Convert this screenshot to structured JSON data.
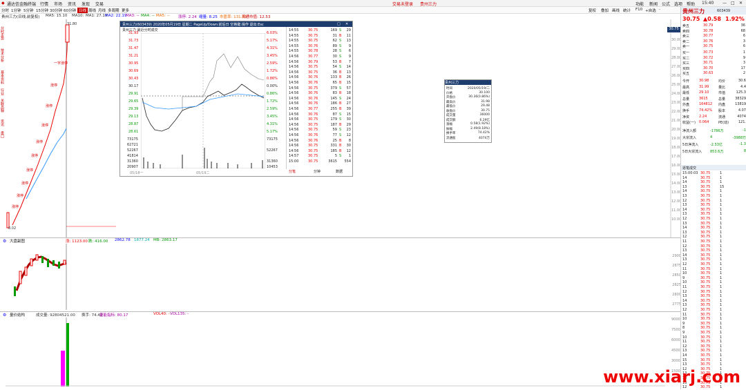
{
  "titlebar": {
    "app": "通达信金融终端",
    "menus": [
      "行情",
      "市场",
      "资讯",
      "发现",
      "交易"
    ],
    "center_items": [
      "交易未登录",
      "贵州三力"
    ],
    "right_items": [
      "功能",
      "新闻",
      "公式",
      "选项",
      "帮助"
    ],
    "time": "15:40"
  },
  "toolbar": {
    "items": [
      "分时",
      "1分钟",
      "5分钟",
      "15分钟",
      "30分钟",
      "60分钟",
      "日线",
      "周线",
      "月线",
      "多周期",
      "更多"
    ],
    "right_items": [
      "复权",
      "叠加",
      "画线",
      "统计",
      "F10",
      "+自选",
      "-"
    ]
  },
  "ma_line": {
    "label": "贵州三力(日线,前复权)",
    "items": [
      {
        "text": "MA5: 15.10",
        "color": "#333"
      },
      {
        "text": "MA10:",
        "color": "#333"
      },
      {
        "text": "MA1: 27.19",
        "color": "#333"
      },
      {
        "text": "MA2: 22.19",
        "color": "#00f"
      },
      {
        "text": "MA3: --",
        "color": "#a0a"
      },
      {
        "text": "MA4: --",
        "color": "#090"
      },
      {
        "text": "MA5: --",
        "color": "#e60"
      }
    ],
    "extra": [
      "涨停: 2.24",
      "缩量: 8.25",
      "市盈率: 131.63",
      "流通市值: 12.53"
    ]
  },
  "left_tabs": [
    "分时走势",
    "技术分析",
    "基本资料",
    "行业",
    "关联品种",
    "资讯",
    "盘口"
  ],
  "main_chart": {
    "high_label": "31.80",
    "low_label": "8.02",
    "annotations": [
      "一字涨停",
      "涨停",
      "涨停",
      "涨停",
      "涨停",
      "涨停",
      "涨停",
      "涨停",
      "涨停",
      "涨停",
      "涨停",
      "涨停"
    ],
    "axis": [
      "30.75",
      "30.00",
      "29.00",
      "28.00",
      "27.00",
      "26.00",
      "25.00",
      "24.00",
      "23.00",
      "22.00",
      "21.00",
      "20.00",
      "19.00",
      "18.00",
      "17.00",
      "16.00",
      "15.00",
      "14.00",
      "13.00",
      "12.00",
      "11.00",
      "10.00"
    ]
  },
  "popup": {
    "title": "贵州三力(603439) 2020年05月19日 星期二 PageUp/Down:前后日 空格键:操作 退出:Esc",
    "subtitle": "贵州三力  最近分时成交",
    "price_left": [
      "31.93",
      "31.73",
      "31.47",
      "31.21",
      "30.95",
      "30.69",
      "30.43",
      "30.17",
      "29.91",
      "29.65",
      "29.39",
      "29.13",
      "28.87",
      "28.61"
    ],
    "pct_right": [
      "6.03%",
      "5.17%",
      "4.31%",
      "3.45%",
      "2.59%",
      "1.72%",
      "0.86%",
      "0.00%",
      "0.86%",
      "1.72%",
      "2.59%",
      "3.45%",
      "4.31%",
      "5.17%"
    ],
    "vol_left": [
      "73175",
      "62721",
      "52267",
      "41814",
      "31360",
      "20907",
      "10453"
    ],
    "date_labels": [
      "05/18一",
      "05/19二"
    ],
    "ticks": [
      {
        "t": "14:55",
        "p": "30.75",
        "v": "169",
        "bs": "S",
        "n": "29"
      },
      {
        "t": "14:55",
        "p": "30.75",
        "v": "31",
        "bs": "B",
        "n": "11"
      },
      {
        "t": "14:55",
        "p": "30.75",
        "v": "62",
        "bs": "S",
        "n": "13"
      },
      {
        "t": "14:55",
        "p": "30.76",
        "v": "89",
        "bs": "S",
        "n": "9"
      },
      {
        "t": "14:55",
        "p": "30.78",
        "v": "28",
        "bs": "S",
        "n": "6"
      },
      {
        "t": "14:56",
        "p": "30.77",
        "v": "30",
        "bs": "S",
        "n": "9"
      },
      {
        "t": "14:56",
        "p": "30.79",
        "v": "53",
        "bs": "B",
        "n": "7"
      },
      {
        "t": "14:56",
        "p": "30.75",
        "v": "54",
        "bs": "S",
        "n": "14"
      },
      {
        "t": "14:56",
        "p": "30.75",
        "v": "36",
        "bs": "B",
        "n": "13"
      },
      {
        "t": "14:56",
        "p": "30.76",
        "v": "133",
        "bs": "B",
        "n": "26"
      },
      {
        "t": "14:56",
        "p": "30.76",
        "v": "65",
        "bs": "B",
        "n": "15"
      },
      {
        "t": "14:56",
        "p": "30.75",
        "v": "379",
        "bs": "S",
        "n": "57"
      },
      {
        "t": "14:56",
        "p": "30.76",
        "v": "83",
        "bs": "B",
        "n": "18"
      },
      {
        "t": "14:56",
        "p": "30.76",
        "v": "145",
        "bs": "S",
        "n": "24"
      },
      {
        "t": "14:56",
        "p": "30.76",
        "v": "186",
        "bs": "B",
        "n": "27"
      },
      {
        "t": "14:56",
        "p": "30.77",
        "v": "255",
        "bs": "B",
        "n": "39"
      },
      {
        "t": "14:56",
        "p": "30.76",
        "v": "87",
        "bs": "S",
        "n": "15"
      },
      {
        "t": "14:56",
        "p": "30.75",
        "v": "179",
        "bs": "S",
        "n": "30"
      },
      {
        "t": "14:56",
        "p": "30.75",
        "v": "187",
        "bs": "B",
        "n": "29"
      },
      {
        "t": "14:56",
        "p": "30.75",
        "v": "59",
        "bs": "S",
        "n": "23"
      },
      {
        "t": "14:56",
        "p": "30.76",
        "v": "77",
        "bs": "S",
        "n": "12"
      },
      {
        "t": "14:56",
        "p": "30.76",
        "v": "25",
        "bs": "B",
        "n": "8"
      },
      {
        "t": "14:56",
        "p": "30.75",
        "v": "331",
        "bs": "B",
        "n": "30"
      },
      {
        "t": "14:56",
        "p": "30.75",
        "v": "185",
        "bs": "B",
        "n": "12"
      },
      {
        "t": "14:57",
        "p": "30.75",
        "v": "5",
        "bs": "S",
        "n": "1"
      },
      {
        "t": "15:00",
        "p": "30.75",
        "v": "3615",
        "bs": "",
        "n": "554"
      }
    ],
    "buttons": [
      "分笔",
      "分钟",
      "数据"
    ]
  },
  "infobox": {
    "title": "贵州三力",
    "rows": [
      {
        "k": "时间",
        "v": "2020/05/19/二"
      },
      {
        "k": "价格",
        "v": "30.100"
      },
      {
        "k": "开盘价",
        "v": "30.36(0.86%)"
      },
      {
        "k": "最高价",
        "v": "31.98"
      },
      {
        "k": "最低价",
        "v": "29.48"
      },
      {
        "k": "收盘价",
        "v": "30.75"
      },
      {
        "k": "成交量",
        "v": "36000"
      },
      {
        "k": "成交额",
        "v": "6.29亿"
      },
      {
        "k": "涨幅",
        "v": "0.58(1.92%)"
      },
      {
        "k": "振幅",
        "v": "2.49(8.18%)"
      },
      {
        "k": "换手率",
        "v": "74.42%"
      },
      {
        "k": "流通股",
        "v": "4074万"
      }
    ]
  },
  "sub1": {
    "title": "大盘副图",
    "values": [
      {
        "text": "涨: 1123.00",
        "color": "#e00"
      },
      {
        "text": "跌: 416.00",
        "color": "#090"
      },
      {
        "text": "2862.78",
        "color": "#00f"
      },
      {
        "text": "1877.24",
        "color": "#0aa"
      },
      {
        "text": "MB: 2863.17",
        "color": "#090"
      }
    ],
    "axis": [
      "2900",
      "2875",
      "2850",
      "2825",
      "2800",
      "2775"
    ]
  },
  "sub2": {
    "title": "量价结构",
    "values": [
      {
        "text": "成交量: 92804521.00",
        "color": "#333"
      },
      {
        "text": "换手: 74.42",
        "color": "#333"
      },
      {
        "text": "量能指标: 80.17",
        "color": "#a0a"
      },
      {
        "text": "VOL40: -",
        "color": "#e00"
      },
      {
        "text": "VOL135: -",
        "color": "#a0a"
      }
    ],
    "axis": [
      "90000",
      "75000",
      "60000",
      "45000",
      "30000",
      "15000",
      "0"
    ]
  },
  "right_panel": {
    "name": "贵州三力",
    "code": "603439",
    "price": "30.75",
    "change": "▲0.58",
    "pct": "1.92%",
    "sells": [
      {
        "lbl": "卖五",
        "p": "30.79",
        "v": "36"
      },
      {
        "lbl": "卖四",
        "p": "30.78",
        "v": "68"
      },
      {
        "lbl": "卖三",
        "p": "30.77",
        "v": "6"
      },
      {
        "lbl": "卖二",
        "p": "30.76",
        "v": "3"
      },
      {
        "lbl": "卖一",
        "p": "30.75",
        "v": "6"
      }
    ],
    "buys": [
      {
        "lbl": "买一",
        "p": "30.73",
        "v": "1"
      },
      {
        "lbl": "买二",
        "p": "30.72",
        "v": "9"
      },
      {
        "lbl": "买三",
        "p": "30.71",
        "v": "3"
      },
      {
        "lbl": "买四",
        "p": "30.70",
        "v": "17"
      },
      {
        "lbl": "买五",
        "p": "30.63",
        "v": "2"
      }
    ],
    "stats": [
      [
        "今开",
        "30.98",
        "均价",
        "30.6"
      ],
      [
        "最高",
        "31.99",
        "量比",
        "4.4"
      ],
      [
        "最低",
        "29.10",
        "市值",
        "125.3"
      ],
      [
        "总量",
        "3615",
        "总量",
        "38329"
      ],
      [
        "外盘",
        "164812",
        "内盘",
        "13819"
      ],
      [
        "换手",
        "74.42%",
        "股本",
        "4.07"
      ],
      [
        "净资",
        "2.24",
        "流通",
        "4074"
      ],
      [
        "收益(一)",
        "0.064",
        "PE(动)",
        "121."
      ]
    ],
    "flow": [
      [
        "净流入额",
        "-1786万",
        "-1"
      ],
      [
        "大宗流入",
        "4",
        "-3988万"
      ],
      [
        "5日净流入",
        "-2.53亿",
        "-1.3"
      ],
      [
        "5日大宗流入",
        "853.6万",
        "8"
      ]
    ],
    "tick_header": "逐笔成交",
    "ticks": [
      [
        "15:00:03",
        "30.75",
        "1"
      ],
      [
        "14",
        "30.75",
        "1"
      ],
      [
        "14",
        "30.75",
        "1"
      ],
      [
        "13",
        "30.75",
        "15"
      ],
      [
        "14",
        "30.75",
        "1"
      ],
      [
        "13",
        "30.75",
        "1"
      ],
      [
        "12",
        "30.75",
        "1"
      ],
      [
        "13",
        "30.75",
        "1"
      ],
      [
        "14",
        "30.75",
        "1"
      ],
      [
        "13",
        "30.75",
        "1"
      ],
      [
        "12",
        "30.75",
        "1"
      ],
      [
        "13",
        "30.75",
        "1"
      ],
      [
        "14",
        "30.75",
        "1"
      ],
      [
        "13",
        "30.75",
        "1"
      ],
      [
        "12",
        "30.75",
        "1"
      ],
      [
        "11",
        "30.75",
        "1"
      ],
      [
        "12",
        "30.75",
        "1"
      ],
      [
        "13",
        "30.75",
        "1"
      ],
      [
        "14",
        "30.75",
        "1"
      ],
      [
        "13",
        "30.75",
        "1"
      ],
      [
        "12",
        "30.75",
        "1"
      ],
      [
        "11",
        "30.75",
        "1"
      ],
      [
        "10",
        "30.75",
        "1"
      ],
      [
        "9",
        "30.75",
        "1"
      ],
      [
        "10",
        "30.75",
        "1"
      ],
      [
        "11",
        "30.75",
        "1"
      ],
      [
        "12",
        "30.75",
        "1"
      ],
      [
        "13",
        "30.75",
        "1"
      ],
      [
        "14",
        "30.75",
        "1"
      ],
      [
        "13",
        "30.75",
        "1"
      ],
      [
        "12",
        "30.75",
        "1"
      ],
      [
        "11",
        "30.75",
        "1"
      ],
      [
        "10",
        "30.75",
        "1"
      ],
      [
        "9",
        "30.75",
        "1"
      ],
      [
        "8",
        "30.75",
        "1"
      ],
      [
        "9",
        "30.75",
        "1"
      ],
      [
        "10",
        "30.75",
        "1"
      ],
      [
        "11",
        "30.75",
        "1"
      ],
      [
        "12",
        "30.75",
        "1"
      ],
      [
        "13",
        "30.75",
        "1"
      ],
      [
        "14",
        "30.75",
        "1"
      ],
      [
        "15",
        "30.75",
        "1"
      ],
      [
        "13",
        "30.75",
        "1"
      ],
      [
        "12",
        "30.75",
        "1"
      ],
      [
        "13",
        "30.75",
        "1"
      ],
      [
        "14",
        "30.75",
        "1"
      ],
      [
        "13",
        "30.75",
        "1"
      ],
      [
        "12",
        "30.75",
        "1"
      ]
    ]
  },
  "watermark": "www.xiarj.com"
}
